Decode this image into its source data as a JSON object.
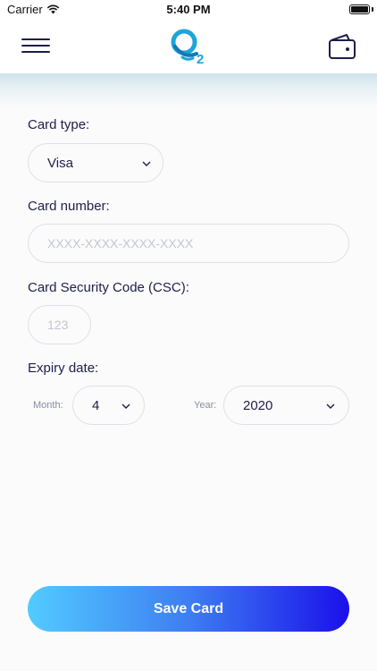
{
  "status_bar": {
    "carrier": "Carrier",
    "time": "5:40 PM"
  },
  "header": {
    "menu_icon": "hamburger-menu-icon",
    "logo_text": "2",
    "wallet_icon": "wallet-icon"
  },
  "form": {
    "card_type_label": "Card type:",
    "card_type_value": "Visa",
    "card_number_label": "Card number:",
    "card_number_placeholder": "XXXX-XXXX-XXXX-XXXX",
    "csc_label": "Card Security Code (CSC):",
    "csc_placeholder": "123",
    "expiry_label": "Expiry date:",
    "month_label": "Month:",
    "month_value": "4",
    "year_label": "Year:",
    "year_value": "2020"
  },
  "actions": {
    "save_label": "Save Card"
  },
  "colors": {
    "primary_text": "#1e1e4a",
    "gradient_start": "#52cbff",
    "gradient_end": "#1a10ea",
    "logo_blue": "#1ea5d8"
  }
}
